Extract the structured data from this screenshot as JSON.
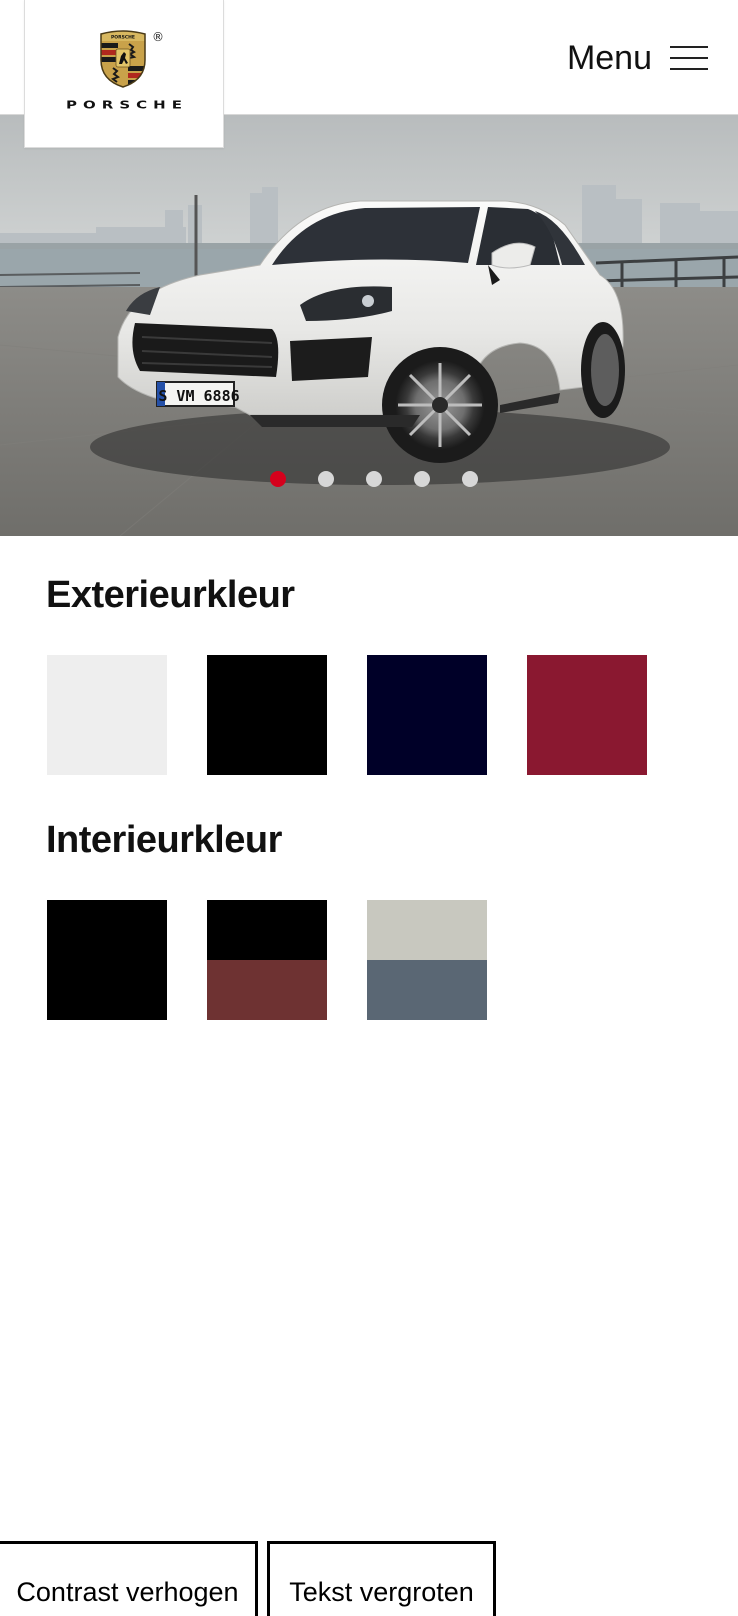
{
  "header": {
    "brand": "PORSCHE",
    "brand_crest_text": "PORSCHE",
    "registered_mark": "®",
    "menu_label": "Menu"
  },
  "hero": {
    "plate_text": "S VM 6886",
    "carousel": {
      "slides": 5,
      "active_index": 0
    }
  },
  "exterior": {
    "title": "Exterieurkleur",
    "colors": [
      "#eeeeee",
      "#000000",
      "#000028",
      "#8a1830"
    ]
  },
  "interior": {
    "title": "Interieurkleur",
    "swatches": [
      {
        "top": "#000000",
        "bottom": "#000000"
      },
      {
        "top": "#000000",
        "bottom": "#6e3232"
      },
      {
        "top": "#c8c8bf",
        "bottom": "#5a6774"
      }
    ]
  },
  "accessibility": {
    "contrast_label": "Contrast verhogen",
    "text_label": "Tekst vergroten"
  },
  "theme": {
    "accent": "#d5001c"
  }
}
